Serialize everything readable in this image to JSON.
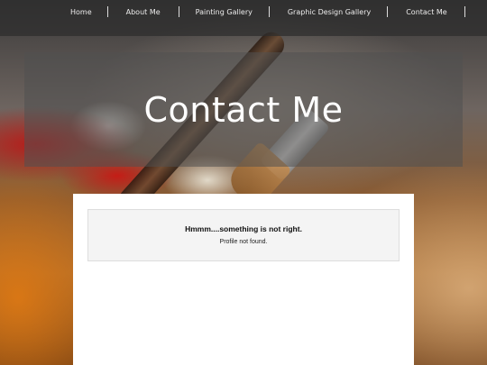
{
  "nav": {
    "items": [
      {
        "label": "Home"
      },
      {
        "label": "About Me"
      },
      {
        "label": "Painting Gallery"
      },
      {
        "label": "Graphic Design Gallery"
      },
      {
        "label": "Contact Me"
      }
    ]
  },
  "hero": {
    "title": "Contact Me"
  },
  "notice": {
    "title": "Hmmm....something is not right.",
    "message": "Profile not found."
  }
}
